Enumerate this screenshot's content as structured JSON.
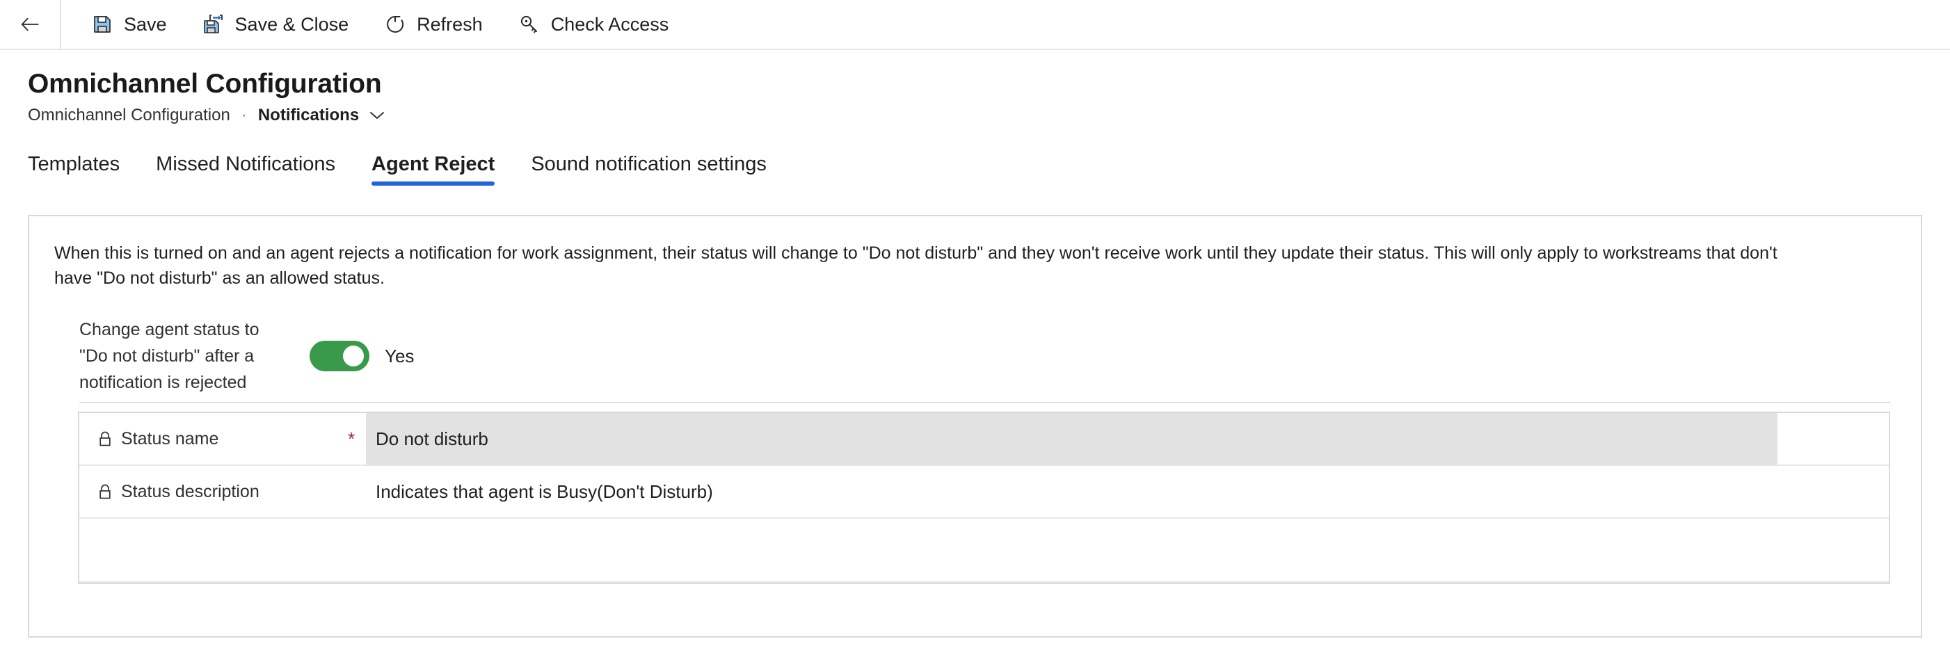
{
  "commandbar": {
    "back_icon": "back-arrow-icon",
    "buttons": [
      {
        "label": "Save",
        "icon": "save-floppy-icon"
      },
      {
        "label": "Save & Close",
        "icon": "save-and-close-icon"
      },
      {
        "label": "Refresh",
        "icon": "refresh-icon"
      },
      {
        "label": "Check Access",
        "icon": "key-icon"
      }
    ]
  },
  "header": {
    "title": "Omnichannel Configuration",
    "breadcrumb": {
      "entity": "Omnichannel Configuration",
      "separator": "·",
      "current": "Notifications",
      "chevron_icon": "chevron-down-icon"
    }
  },
  "tabs": [
    {
      "label": "Templates",
      "active": false
    },
    {
      "label": "Missed Notifications",
      "active": false
    },
    {
      "label": "Agent Reject",
      "active": true
    },
    {
      "label": "Sound notification settings",
      "active": false
    }
  ],
  "panel": {
    "description": "When this is turned on and an agent rejects a notification for work assignment, their status will change to \"Do not disturb\" and they won't receive work until they update their status. This will only apply to workstreams that don't have \"Do not disturb\" as an allowed status.",
    "toggle_field": {
      "label": "Change agent status to \"Do not disturb\" after a notification is rejected",
      "state_label": "Yes",
      "checked": true,
      "on_color": "#3a9a4b"
    },
    "fields": [
      {
        "label": "Status name",
        "value": "Do not disturb",
        "required": true,
        "required_marker": "*",
        "locked": true,
        "lock_icon": "lock-icon",
        "highlighted": true
      },
      {
        "label": "Status description",
        "value": "Indicates that agent is Busy(Don't Disturb)",
        "required": false,
        "required_marker": "",
        "locked": true,
        "lock_icon": "lock-icon",
        "highlighted": false
      }
    ]
  },
  "colors": {
    "accent": "#2266dd",
    "toggle_on": "#3a9a4b",
    "required": "#a4262c",
    "field_highlight": "#e2e2e2",
    "border": "#d9d9d9"
  }
}
